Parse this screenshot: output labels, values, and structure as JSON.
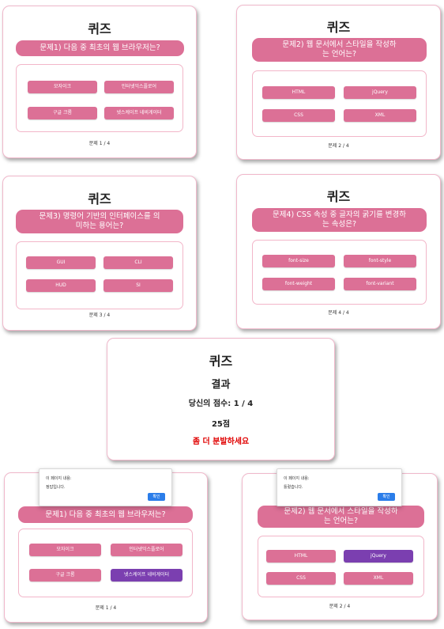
{
  "title": "퀴즈",
  "cards": [
    {
      "question": "문제1) 다음 중 최초의 웹 브라우저는?",
      "options": [
        "모자이크",
        "인터넷익스플로어",
        "구글 크롬",
        "넷스케이프 네비게이터"
      ],
      "progress": "문제 1 / 4"
    },
    {
      "question": "문제2) 웹 문서에서 스타일을 작성하는 언어는?",
      "options": [
        "HTML",
        "jQuery",
        "CSS",
        "XML"
      ],
      "progress": "문제 2 / 4"
    },
    {
      "question": "문제3) 명령어 기반의 인터페이스를 의미하는 용어는?",
      "options": [
        "GUI",
        "CLI",
        "HUD",
        "SI"
      ],
      "progress": "문제 3 / 4"
    },
    {
      "question": "문제4) CSS 속성 중 글자의 굵기를 변경하는 속성은?",
      "options": [
        "font-size",
        "font-style",
        "font-weight",
        "font-variant"
      ],
      "progress": "문제 4 / 4"
    }
  ],
  "result": {
    "title": "퀴즈",
    "heading": "결과",
    "score": "당신의 점수: 1 / 4",
    "points": "25점",
    "message": "좀 더 분발하세요",
    "message_color": "#e00000"
  },
  "dialogs": [
    {
      "title": "이 페이지 내용:",
      "message": "정답입니다.",
      "ok": "확인",
      "selected_option": "넷스케이프 네비게이터"
    },
    {
      "title": "이 페이지 내용:",
      "message": "틀렸습니다.",
      "ok": "확인",
      "selected_option": "jQuery"
    }
  ],
  "colors": {
    "accent": "#dc7096",
    "selected": "#7b3fb0",
    "ok_button": "#2b7de9"
  }
}
